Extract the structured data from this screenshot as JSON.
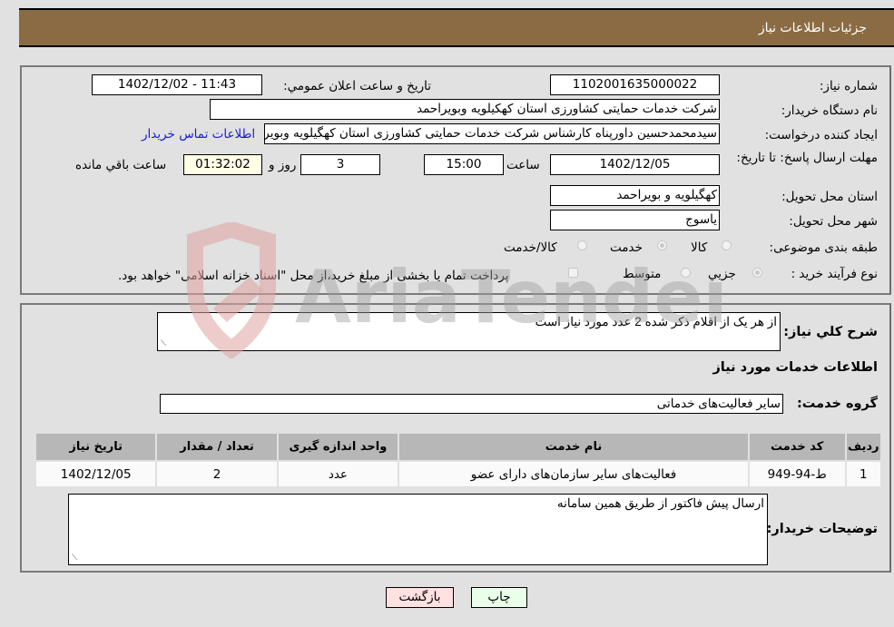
{
  "header": {
    "title": "جزئیات اطلاعات نیاز"
  },
  "details": {
    "need_number": {
      "label": "شماره نیاز:",
      "value": "1102001635000022"
    },
    "announce_datetime": {
      "label": "تاریخ و ساعت اعلان عمومي:",
      "value": "1402/12/02 - 11:43"
    },
    "buyer_org": {
      "label": "نام دستگاه خریدار:",
      "value": "شرکت خدمات حمایتی کشاورزی استان کهکیلویه وبویراحمد"
    },
    "creator": {
      "label": "ایجاد کننده درخواست:",
      "value": "سیدمحمدحسین داورپناه کارشناس شرکت خدمات حمایتی کشاورزی استان کهگیلویه وبویراحمد"
    },
    "contact_link": "اطلاعات تماس خریدار",
    "deadline": {
      "label": "مهلت ارسال پاسخ: تا تاریخ:",
      "date": "1402/12/05",
      "time_label": "ساعت",
      "time": "15:00",
      "days": "3",
      "days_label": "روز و",
      "remaining": "01:32:02",
      "remaining_label": "ساعت باقي مانده"
    },
    "province": {
      "label": "استان محل تحویل:",
      "value": "کهگیلویه و بویراحمد"
    },
    "city": {
      "label": "شهر محل تحویل:",
      "value": "یاسوج"
    },
    "category": {
      "label": "طبقه بندی موضوعی:",
      "options": [
        "کالا",
        "خدمت",
        "کالا/خدمت"
      ],
      "selected": "خدمت"
    },
    "purchase_type": {
      "label": "نوع فرآیند خرید :",
      "options": [
        "جزيي",
        "متوسط"
      ],
      "selected": "جزيي",
      "treasury_note": "پرداخت تمام یا بخشی از مبلغ خرید،از محل \"اسناد خزانه اسلامی\" خواهد بود."
    }
  },
  "description": {
    "label": "شرح کلي نیاز:",
    "value": "از هر یک از اقلام ذکر شده 2 عدد مورد نیاز است"
  },
  "services_section": {
    "title": "اطلاعات خدمات مورد نیاز",
    "group_label": "گروه خدمت:",
    "group_value": "سایر فعالیت‌های خدماتی",
    "table": {
      "columns": [
        "ردیف",
        "کد خدمت",
        "نام خدمت",
        "واحد اندازه گیری",
        "تعداد / مقدار",
        "تاریخ نیاز"
      ],
      "rows": [
        [
          "1",
          "ط-94-949",
          "فعالیت‌های سایر سازمان‌های دارای عضو",
          "عدد",
          "2",
          "1402/12/05"
        ]
      ]
    }
  },
  "buyer_notes": {
    "label": "توضیحات خریدار:",
    "value": "ارسال پیش فاکتور از طریق همین سامانه"
  },
  "buttons": {
    "print": "چاپ",
    "back": "بازگشت"
  },
  "watermark": "AriaTender.neT",
  "colors": {
    "header_bg": "#8b6b43",
    "link": "#1a1ad6",
    "back_btn": "#ffe1e1",
    "print_btn": "#eaffea",
    "remaining_bg": "#ffffe6"
  }
}
